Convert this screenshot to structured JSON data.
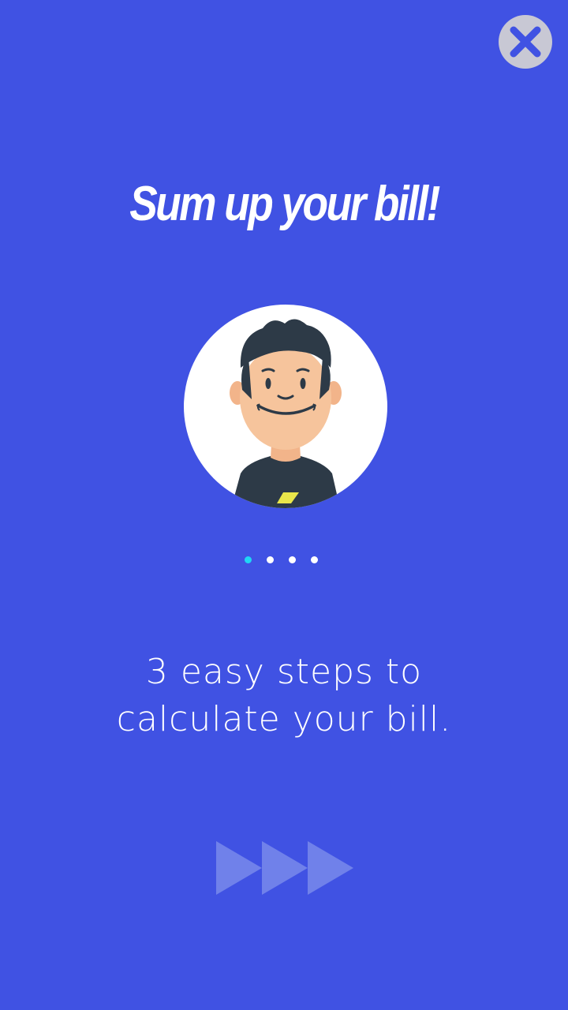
{
  "header": {
    "close_icon": "close-icon"
  },
  "onboarding": {
    "title": "Sum up your bill!",
    "illustration": "avatar-illustration",
    "pager": {
      "total": 4,
      "active_index": 0
    },
    "description_line1": "3 easy steps to",
    "description_line2": "calculate your bill.",
    "next_icon": "fast-forward-icon"
  },
  "colors": {
    "background": "#4052e3",
    "accent": "#1fd6f5",
    "close_bg": "#c8c8d4",
    "close_x": "#4052e3",
    "next_arrows": "#7081ea"
  }
}
